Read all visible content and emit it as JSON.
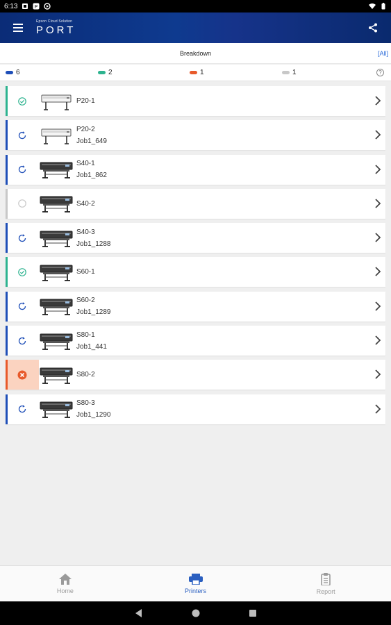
{
  "statusbar": {
    "time": "6:13"
  },
  "appbar": {
    "logo_small": "Epson Cloud Solution",
    "logo_big": "PORT"
  },
  "breakdown": {
    "title": "Breakdown",
    "all_label": "[All]"
  },
  "legend": [
    {
      "count": "6",
      "color": "#1f4fb8"
    },
    {
      "count": "2",
      "color": "#2db38f"
    },
    {
      "count": "1",
      "color": "#e85a2b"
    },
    {
      "count": "1",
      "color": "#c8c8c8"
    }
  ],
  "colors": {
    "printing": "#1f4fb8",
    "ready": "#2db38f",
    "error": "#e85a2b",
    "offline": "#c8c8c8"
  },
  "printers": [
    {
      "name": "P20-1",
      "job": "",
      "status": "ready"
    },
    {
      "name": "P20-2",
      "job": "Job1_649",
      "status": "printing"
    },
    {
      "name": "S40-1",
      "job": "Job1_862",
      "status": "printing"
    },
    {
      "name": "S40-2",
      "job": "",
      "status": "offline"
    },
    {
      "name": "S40-3",
      "job": "Job1_1288",
      "status": "printing"
    },
    {
      "name": "S60-1",
      "job": "",
      "status": "ready"
    },
    {
      "name": "S60-2",
      "job": "Job1_1289",
      "status": "printing"
    },
    {
      "name": "S80-1",
      "job": "Job1_441",
      "status": "printing"
    },
    {
      "name": "S80-2",
      "job": "",
      "status": "error"
    },
    {
      "name": "S80-3",
      "job": "Job1_1290",
      "status": "printing"
    }
  ],
  "nav": {
    "home": "Home",
    "printers": "Printers",
    "report": "Report"
  }
}
